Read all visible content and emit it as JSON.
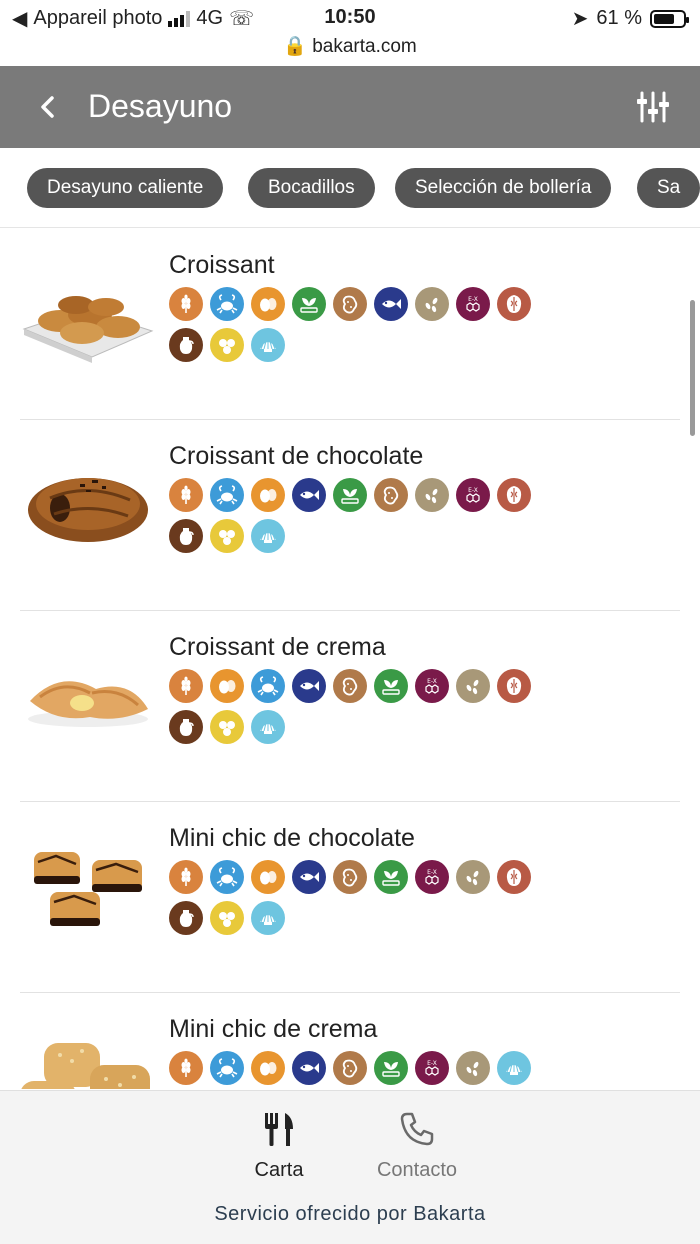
{
  "status_bar": {
    "carrier": "Appareil photo",
    "network": "4G",
    "time": "10:50",
    "battery": "61 %",
    "url": "bakarta.com"
  },
  "header": {
    "title": "Desayuno"
  },
  "categories": [
    {
      "label": "Desayuno caliente"
    },
    {
      "label": "Bocadillos"
    },
    {
      "label": "Selección de bollería"
    },
    {
      "label": "Sa"
    }
  ],
  "allergen_colors": {
    "gluten-icon": "#d9833e",
    "crustacean-icon": "#3d9bd8",
    "egg-icon": "#e8952f",
    "fish-icon": "#2a3a8c",
    "peanut-icon": "#b07a4a",
    "celery-icon": "#3a9a46",
    "sulphite-icon": "#7a1a4a",
    "sesame-icon": "#a89878",
    "nut-icon": "#b85a45",
    "milk-icon": "#6a3a1e",
    "soy-icon": "#e8c93a",
    "mollusc-icon": "#6ec5e0"
  },
  "products": [
    {
      "name": "Croissant",
      "allergens": [
        "gluten-icon",
        "crustacean-icon",
        "egg-icon",
        "celery-icon",
        "peanut-icon",
        "fish-icon",
        "sesame-icon",
        "sulphite-icon",
        "nut-icon",
        "milk-icon",
        "soy-icon",
        "mollusc-icon"
      ]
    },
    {
      "name": "Croissant de chocolate",
      "allergens": [
        "gluten-icon",
        "crustacean-icon",
        "egg-icon",
        "fish-icon",
        "celery-icon",
        "peanut-icon",
        "sesame-icon",
        "sulphite-icon",
        "nut-icon",
        "milk-icon",
        "soy-icon",
        "mollusc-icon"
      ]
    },
    {
      "name": "Croissant de crema",
      "allergens": [
        "gluten-icon",
        "egg-icon",
        "crustacean-icon",
        "fish-icon",
        "peanut-icon",
        "celery-icon",
        "sulphite-icon",
        "sesame-icon",
        "nut-icon",
        "milk-icon",
        "soy-icon",
        "mollusc-icon"
      ]
    },
    {
      "name": "Mini chic de chocolate",
      "allergens": [
        "gluten-icon",
        "crustacean-icon",
        "egg-icon",
        "fish-icon",
        "peanut-icon",
        "celery-icon",
        "sulphite-icon",
        "sesame-icon",
        "nut-icon",
        "milk-icon",
        "soy-icon",
        "mollusc-icon"
      ]
    },
    {
      "name": "Mini chic de crema",
      "allergens": [
        "gluten-icon",
        "crustacean-icon",
        "egg-icon",
        "fish-icon",
        "peanut-icon",
        "celery-icon",
        "sulphite-icon",
        "sesame-icon",
        "mollusc-icon"
      ]
    }
  ],
  "footer": {
    "tabs": [
      {
        "label": "Carta",
        "icon": "cutlery-icon",
        "active": true
      },
      {
        "label": "Contacto",
        "icon": "phone-icon",
        "active": false
      }
    ],
    "credit": "Servicio ofrecido por Bakarta"
  }
}
